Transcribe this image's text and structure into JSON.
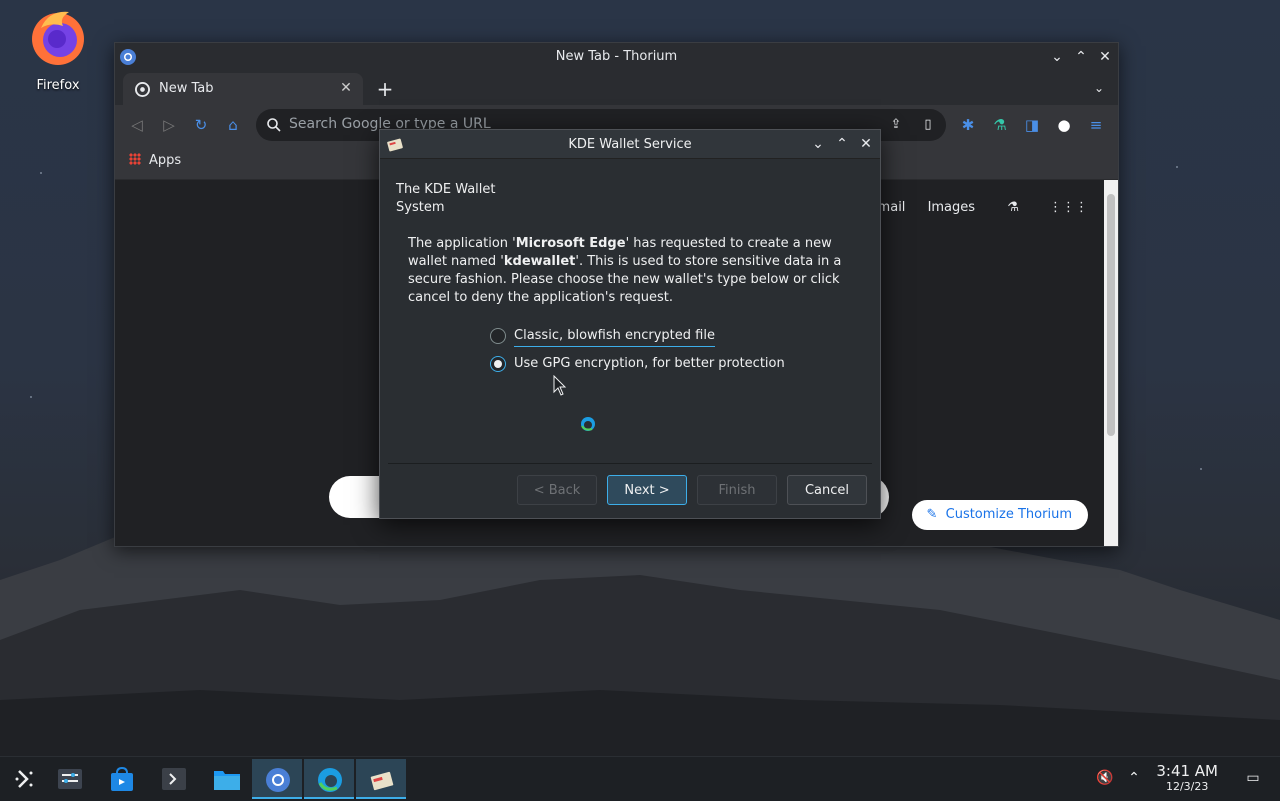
{
  "desktop": {
    "icons": [
      {
        "label": "Firefox",
        "icon": "firefox-icon"
      }
    ]
  },
  "browser": {
    "window_title": "New Tab - Thorium",
    "tab": {
      "title": "New Tab"
    },
    "omnibox": {
      "placeholder": "Search Google or type a URL"
    },
    "bookmarks": {
      "apps_label": "Apps"
    },
    "page": {
      "links": [
        "Gmail",
        "Images"
      ],
      "customize_label": "Customize Thorium"
    }
  },
  "dialog": {
    "title": "KDE Wallet Service",
    "heading": "The KDE Wallet System",
    "body": {
      "part1": "The application '",
      "app": "Microsoft Edge",
      "part2": "' has requested to create a new wallet named '",
      "wallet": "kdewallet",
      "part3": "'. This is used to store sensitive data in a secure fashion. Please choose the new wallet's type below or click cancel to deny the application's request."
    },
    "options": [
      {
        "label": "Classic, blowfish encrypted file",
        "checked": false
      },
      {
        "label": "Use GPG encryption, for better protection",
        "checked": true
      }
    ],
    "buttons": {
      "back": "< Back",
      "next": "Next >",
      "finish": "Finish",
      "cancel": "Cancel"
    }
  },
  "taskbar": {
    "clock": {
      "time": "3:41 AM",
      "date": "12/3/23"
    },
    "items": [
      "app-launcher-icon",
      "system-settings-icon",
      "discover-store-icon",
      "konsole-icon",
      "dolphin-files-icon",
      "thorium-browser-icon",
      "microsoft-edge-icon",
      "kde-wallet-icon"
    ]
  },
  "colors": {
    "accent": "#3daee9",
    "dialog_bg": "#2a2e32",
    "browser_bg": "#202124"
  }
}
